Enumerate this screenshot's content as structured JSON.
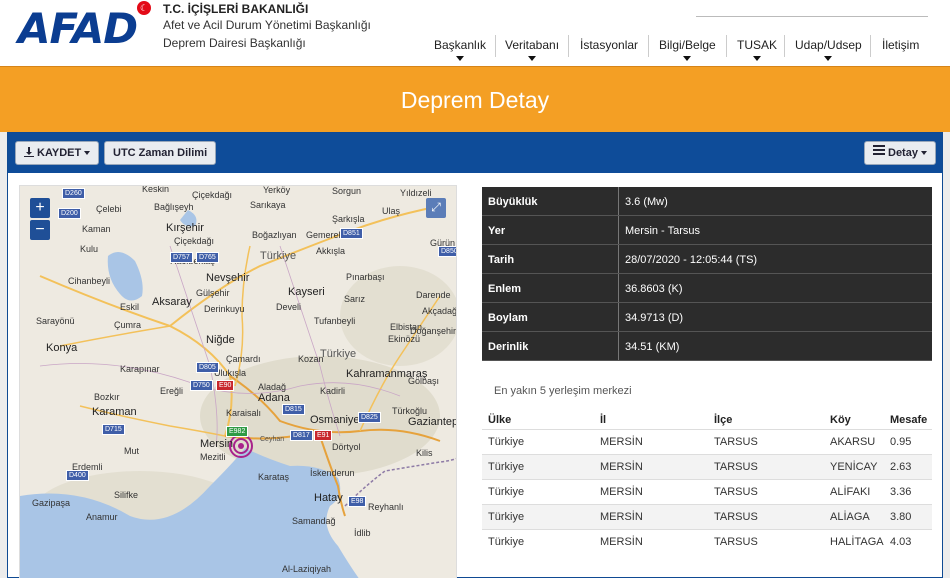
{
  "header": {
    "logo": "AFAD",
    "org_line1": "T.C. İÇİŞLERİ BAKANLIĞI",
    "org_line2": "Afet ve Acil Durum Yönetimi Başkanlığı",
    "org_line3": "Deprem Dairesi Başkanlığı",
    "nav": [
      {
        "label": "Başkanlık",
        "dropdown": true
      },
      {
        "label": "Veritabanı",
        "dropdown": true
      },
      {
        "label": "İstasyonlar",
        "dropdown": false
      },
      {
        "label": "Bilgi/Belge",
        "dropdown": true
      },
      {
        "label": "TUSAK",
        "dropdown": true
      },
      {
        "label": "Udap/Udsep",
        "dropdown": true
      },
      {
        "label": "İletişim",
        "dropdown": false
      }
    ]
  },
  "page": {
    "title": "Deprem Detay"
  },
  "toolbar": {
    "save_label": "KAYDET",
    "utc_label": "UTC Zaman Dilimi",
    "detail_label": "Detay"
  },
  "map": {
    "zoom_in": "+",
    "zoom_out": "−",
    "cities": [
      {
        "name": "Keskin"
      },
      {
        "name": "Çiçekdağı"
      },
      {
        "name": "Yerköy"
      },
      {
        "name": "Sorgun"
      },
      {
        "name": "Çelebi"
      },
      {
        "name": "Bağlışeyh"
      },
      {
        "name": "Sarıkaya"
      },
      {
        "name": "Yıldızeli"
      },
      {
        "name": "Kaman"
      },
      {
        "name": "Boğazlıyan"
      },
      {
        "name": "Gemerek"
      },
      {
        "name": "Şarkışla"
      },
      {
        "name": "Kırşehir"
      },
      {
        "name": "Ulaş"
      },
      {
        "name": "Çiçekdağı"
      },
      {
        "name": "Türkiye"
      },
      {
        "name": "Akkışla"
      },
      {
        "name": "Gürün"
      },
      {
        "name": "Kulu"
      },
      {
        "name": "Hacıbektaş"
      },
      {
        "name": "Nevşehir"
      },
      {
        "name": "Pınarbaşı"
      },
      {
        "name": "Cihanbeyli"
      },
      {
        "name": "Gülşehir"
      },
      {
        "name": "Derinkuyu"
      },
      {
        "name": "Kayseri"
      },
      {
        "name": "Sarız"
      },
      {
        "name": "Darende"
      },
      {
        "name": "Eskil"
      },
      {
        "name": "Aksaray"
      },
      {
        "name": "Develi"
      },
      {
        "name": "Akçadağ"
      },
      {
        "name": "Sarayönü"
      },
      {
        "name": "Tufanbeyli"
      },
      {
        "name": "Doğanşehir"
      },
      {
        "name": "Çumra"
      },
      {
        "name": "Niğde"
      },
      {
        "name": "Elbistan"
      },
      {
        "name": "Konya"
      },
      {
        "name": "Çamardı"
      },
      {
        "name": "Kozan"
      },
      {
        "name": "Ekinözü"
      },
      {
        "name": "Karapınar"
      },
      {
        "name": "Ulukışla"
      },
      {
        "name": "Kahramanmaraş"
      },
      {
        "name": "Ereğli"
      },
      {
        "name": "Aladağ"
      },
      {
        "name": "Gölbaşı"
      },
      {
        "name": "Kadirli"
      },
      {
        "name": "Bozkır"
      },
      {
        "name": "Adana"
      },
      {
        "name": "Karaman"
      },
      {
        "name": "Karaisalı"
      },
      {
        "name": "Osmaniye"
      },
      {
        "name": "Türkoğlu"
      },
      {
        "name": "Gaziantep"
      },
      {
        "name": "Mersin"
      },
      {
        "name": "Mezitli"
      },
      {
        "name": "Dörtyol"
      },
      {
        "name": "Kilis"
      },
      {
        "name": "Mut"
      },
      {
        "name": "Erdemli"
      },
      {
        "name": "Karataş"
      },
      {
        "name": "İskenderun"
      },
      {
        "name": "Silifke"
      },
      {
        "name": "Hatay"
      },
      {
        "name": "Gazipaşa"
      },
      {
        "name": "Anamur"
      },
      {
        "name": "Samandağ"
      },
      {
        "name": "Reyhanlı"
      },
      {
        "name": "İdlib"
      },
      {
        "name": "Al-Laziqiyah"
      },
      {
        "name": "Türkiye"
      },
      {
        "name": "Ceyhan"
      }
    ],
    "roads": [
      "D260",
      "D200",
      "D757",
      "D765",
      "D851",
      "D850",
      "D805",
      "D750",
      "E90",
      "D815",
      "D825",
      "D817",
      "E91",
      "E982",
      "D715",
      "E98",
      "D400"
    ]
  },
  "details": [
    {
      "key": "Büyüklük",
      "value": "3.6 (Mw)"
    },
    {
      "key": "Yer",
      "value": "Mersin - Tarsus"
    },
    {
      "key": "Tarih",
      "value": "28/07/2020 - 12:05:44 (TS)"
    },
    {
      "key": "Enlem",
      "value": "36.8603 (K)"
    },
    {
      "key": "Boylam",
      "value": "34.9713 (D)"
    },
    {
      "key": "Derinlik",
      "value": "34.51 (KM)"
    }
  ],
  "nearest": {
    "title": "En yakın 5 yerleşim merkezi",
    "columns": [
      "Ülke",
      "İl",
      "İlçe",
      "Köy",
      "Mesafe"
    ],
    "rows": [
      [
        "Türkiye",
        "MERSİN",
        "TARSUS",
        "AKARSU",
        "0.95"
      ],
      [
        "Türkiye",
        "MERSİN",
        "TARSUS",
        "YENİCAY",
        "2.63"
      ],
      [
        "Türkiye",
        "MERSİN",
        "TARSUS",
        "ALİFAKI",
        "3.36"
      ],
      [
        "Türkiye",
        "MERSİN",
        "TARSUS",
        "ALİAGA",
        "3.80"
      ],
      [
        "Türkiye",
        "MERSİN",
        "TARSUS",
        "HALİTAGA",
        "4.03"
      ]
    ]
  },
  "colors": {
    "brand": "#0b3d91",
    "band": "#f49f24",
    "toolbar": "#0e4c99",
    "detail_row": "#2c2c2c",
    "epicenter": "#a8228c"
  }
}
